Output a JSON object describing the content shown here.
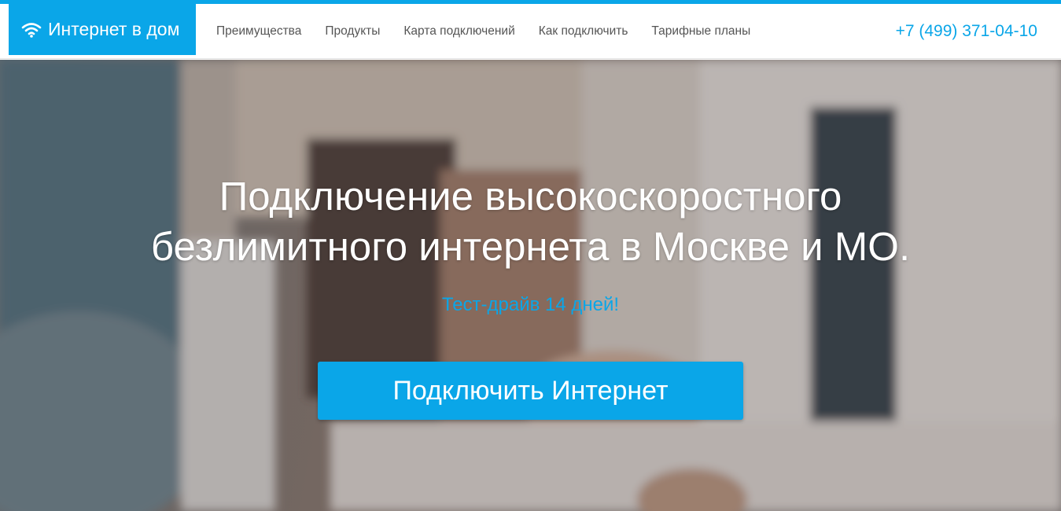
{
  "colors": {
    "accent": "#0aa6e8",
    "nav_text": "#555555",
    "header_bg": "#ffffff"
  },
  "logo": {
    "icon": "wifi-icon",
    "label": "Интернет в дом"
  },
  "nav": {
    "items": [
      {
        "label": "Преимущества"
      },
      {
        "label": "Продукты"
      },
      {
        "label": "Карта подключений"
      },
      {
        "label": "Как подключить"
      },
      {
        "label": "Тарифные планы"
      }
    ]
  },
  "phone": "+7 (499) 371-04-10",
  "hero": {
    "title_line1": "Подключение высокоскоростного",
    "title_line2": "безлимитного интернета в Москве и МО.",
    "subtitle": "Тест-драйв 14 дней!",
    "cta_label": "Подключить Интернет"
  }
}
